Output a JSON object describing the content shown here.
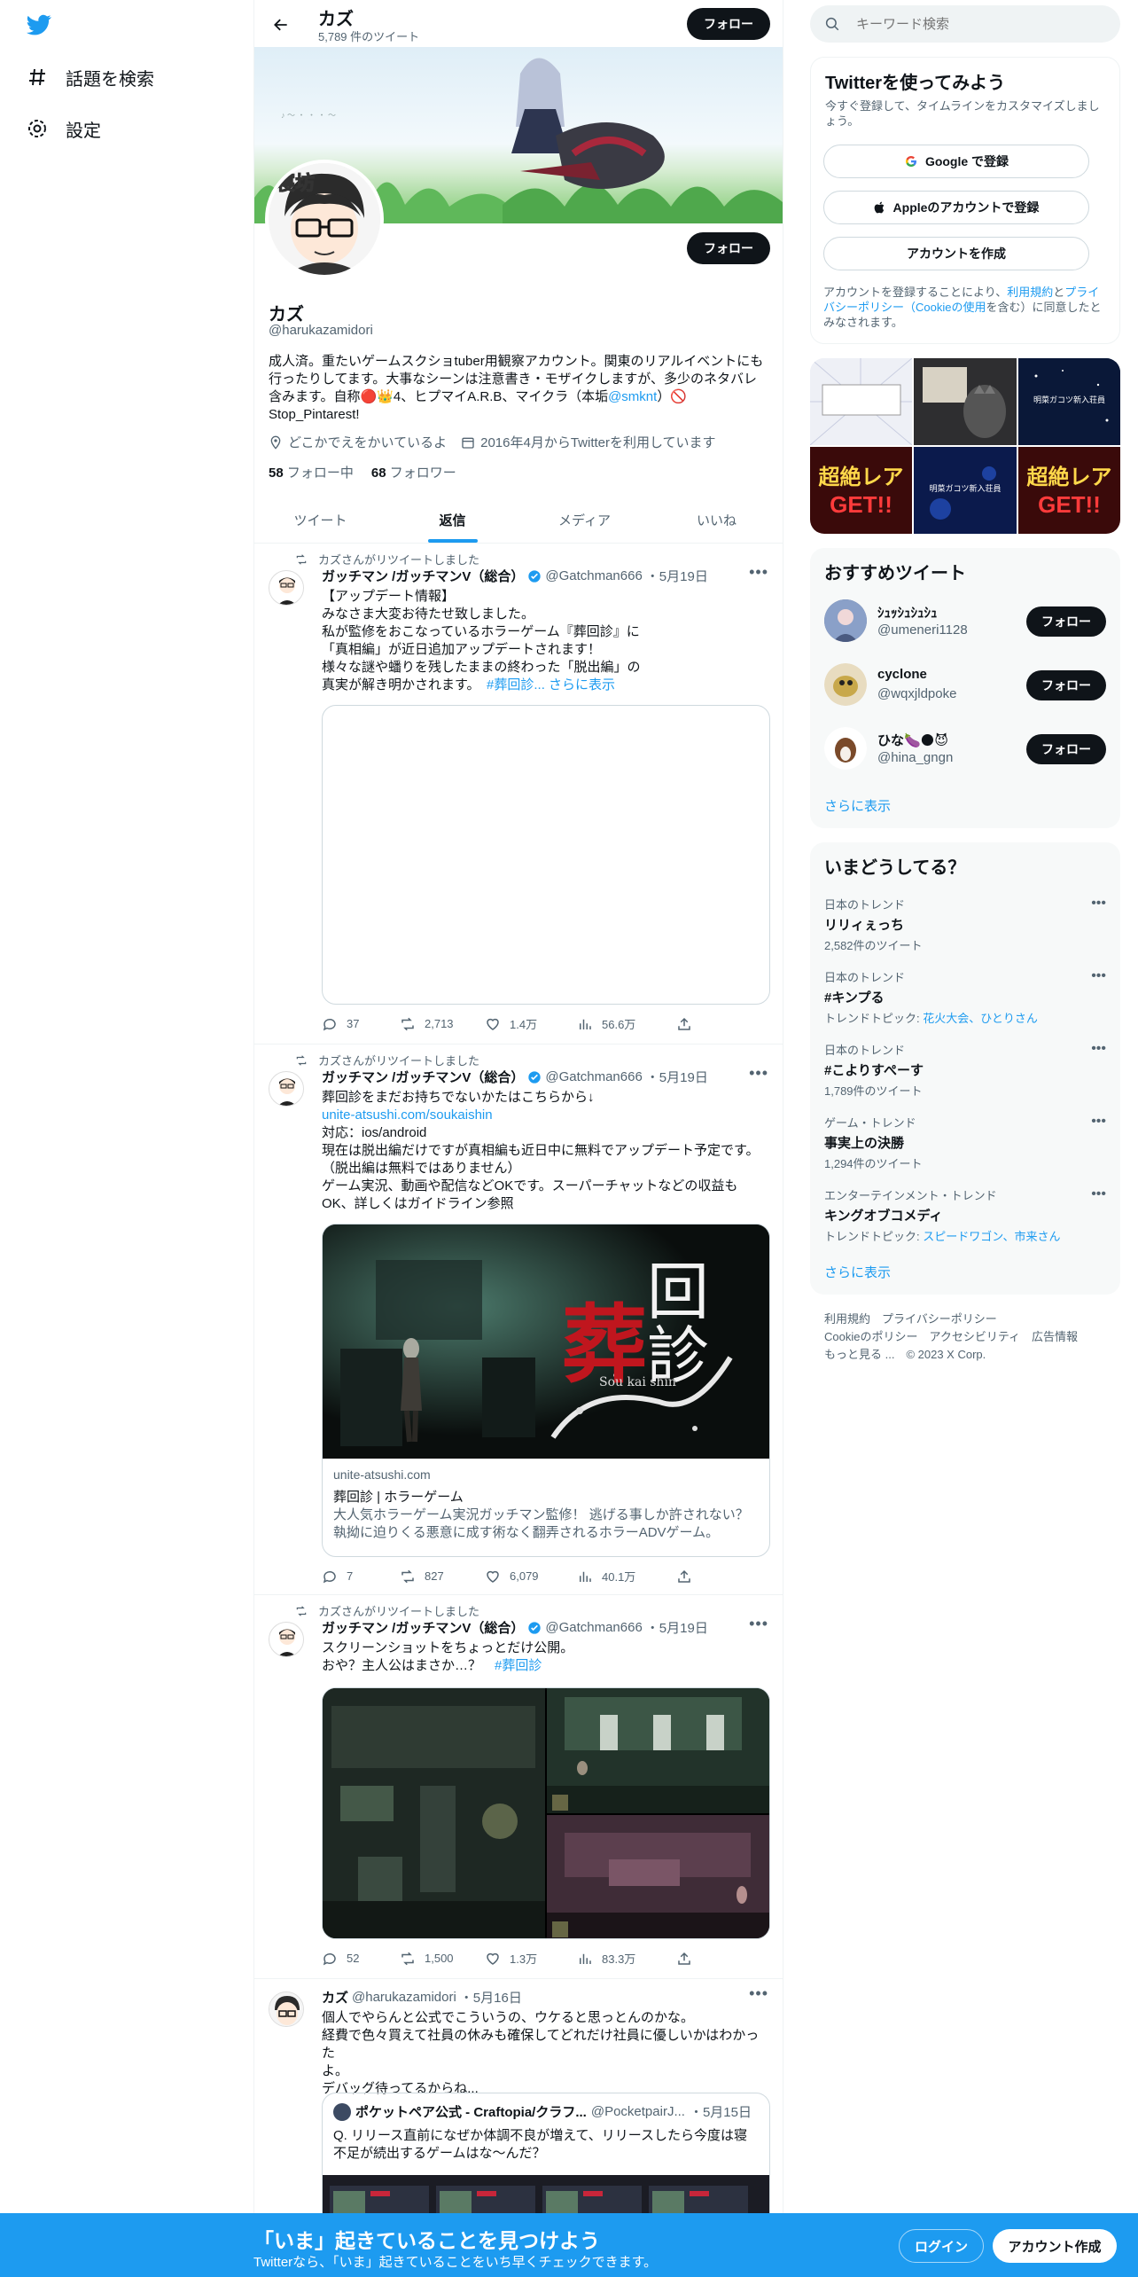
{
  "nav": {
    "search_label": "話題を検索",
    "settings_label": "設定"
  },
  "header": {
    "name": "カズ",
    "tweet_count": "5,789 件のツイート",
    "follow_label": "フォロー"
  },
  "profile": {
    "name": "カズ",
    "handle": "@harukazamidori",
    "follow_label": "フォロー",
    "bio_line1": "成人済。重たいゲームスクショtuber用観察アカウント。関東のリアルイベントにも",
    "bio_line2": "行ったりしてます。大事なシーンは注意書き・モザイクしますが、多少のネタバレ",
    "bio_line3a": "含みます。自称🔴👑4、ヒプマイA.R.B、マイクラ（本垢",
    "bio_mention": "@smknt",
    "bio_line3b": "）🚫",
    "bio_line4": "Stop_Pintarest!",
    "location": "どこかでえをかいているよ",
    "joined": "2016年4月からTwitterを利用しています",
    "following_count": "58",
    "following_label": "フォロー中",
    "followers_count": "68",
    "followers_label": "フォロワー"
  },
  "tabs": [
    "ツイート",
    "返信",
    "メディア",
    "いいね"
  ],
  "tweets": [
    {
      "retweet_label": "カズさんがリツイートしました",
      "author": "ガッチマン /ガッチマンV（総合）",
      "handle": "@Gatchman666",
      "date": "・5月19日",
      "lines": [
        "【アップデート情報】",
        "みなさま大変お待たせ致しました。",
        "私が監修をおこなっているホラーゲーム『葬回診』に",
        "「真相編」が近日追加アップデートされます！",
        "様々な謎や蟠りを残したままの終わった「脱出編」の"
      ],
      "last_line": "真実が解き明かされます。",
      "hashtag": "#葬回診",
      "show_more": "... さらに表示",
      "replies": "37",
      "retweets": "2,713",
      "likes": "1.4万",
      "views": "56.6万"
    },
    {
      "retweet_label": "カズさんがリツイートしました",
      "author": "ガッチマン /ガッチマンV（総合）",
      "handle": "@Gatchman666",
      "date": "・5月19日",
      "line1": "葬回診をまだお持ちでないかたはこちらから↓",
      "link": "unite-atsushi.com/soukaishin",
      "lines": [
        "対応：ios/android",
        "現在は脱出編だけですが真相編も近日中に無料でアップデート予定です。",
        "（脱出編は無料ではありません）",
        "ゲーム実況、動画や配信などOKです。スーパーチャットなどの収益も",
        "OK、詳しくはガイドライン参照"
      ],
      "card_title_a": "葬",
      "card_title_b": "回診",
      "card_sub": "Sou kai shin",
      "card_domain": "unite-atsushi.com",
      "card_title": "葬回診 | ホラーゲーム",
      "card_desc1": "大人気ホラーゲーム実況ガッチマン監修！ 逃げる事しか許されない？",
      "card_desc2": "執拗に迫りくる悪意に成す術なく翻弄されるホラーADVゲーム。",
      "replies": "7",
      "retweets": "827",
      "likes": "6,079",
      "views": "40.1万"
    },
    {
      "retweet_label": "カズさんがリツイートしました",
      "author": "ガッチマン /ガッチマンV（総合）",
      "handle": "@Gatchman666",
      "date": "・5月19日",
      "line1": "スクリーンショットをちょっとだけ公開。",
      "line2": "おや？主人公はまさか…？",
      "hashtag": "#葬回診",
      "replies": "52",
      "retweets": "1,500",
      "likes": "1.3万",
      "views": "83.3万"
    },
    {
      "author": "カズ",
      "handle": "@harukazamidori",
      "date": "・5月16日",
      "lines": [
        "個人でやらんと公式でこういうの、ウケると思っとんのかな。",
        "経費で色々買えて社員の休みも確保してどれだけ社員に優しいかはわかった",
        "よ。",
        "デバッグ待ってるからね..."
      ],
      "quote_author": "ポケットペア公式 - Craftopia/クラフ...",
      "quote_handle": "@PocketpairJ...",
      "quote_date": "・5月15日",
      "quote_line1": "Q. リリース直前になぜか体調不良が増えて、リリースしたら今度は寝",
      "quote_line2": "不足が続出するゲームはな～んだ？"
    }
  ],
  "right": {
    "search_placeholder": "キーワード検索",
    "signup_title": "Twitterを使ってみよう",
    "signup_sub": "今すぐ登録して、タイムラインをカスタマイズしましょう。",
    "google_btn": "Google で登録",
    "apple_btn": "Appleのアカウントで登録",
    "create_btn": "アカウントを作成",
    "terms_a": "アカウントを登録することにより、",
    "terms_link1": "利用規約",
    "terms_b": "と",
    "terms_link2": "プライバシーポリシー（Cookieの使用",
    "terms_c": "を含む）に同意したとみなされます。",
    "media_labels": [
      "超絶レア",
      "GET!!",
      "明菜ガコツ新入荘員"
    ],
    "recommend_title": "おすすめツイート",
    "recommend": [
      {
        "name": "ｼｭｯｼｭｼｭｼｭ",
        "handle": "@umeneri1128"
      },
      {
        "name": "cyclone",
        "handle": "@wqxjldpoke"
      },
      {
        "name": "ひな🍆🌑😈",
        "handle": "@hina_gngn"
      }
    ],
    "follow_label": "フォロー",
    "show_more": "さらに表示",
    "trends_title": "いまどうしてる？",
    "trends": [
      {
        "cat": "日本のトレンド",
        "name": "リリィぇっち",
        "sub": "2,582件のツイート"
      },
      {
        "cat": "日本のトレンド",
        "name": "#キンプる",
        "sub_label": "トレンドトピック: ",
        "sub_link": "花火大会、ひとりさん"
      },
      {
        "cat": "日本のトレンド",
        "name": "#こよりすぺーす",
        "sub": "1,789件のツイート"
      },
      {
        "cat": "ゲーム・トレンド",
        "name": "事実上の決勝",
        "sub": "1,294件のツイート"
      },
      {
        "cat": "エンターテインメント・トレンド",
        "name": "キングオブコメディ",
        "sub_label": "トレンドトピック: ",
        "sub_link": "スピードワゴン、市来さん"
      }
    ],
    "footer1": "利用規約　プライバシーポリシー",
    "footer2": "Cookieのポリシー　アクセシビリティ　広告情報",
    "footer3": "もっと見る ...　© 2023 X Corp."
  },
  "bottom": {
    "title": "「いま」起きていることを見つけよう",
    "subtitle": "Twitterなら、「いま」起きていることをいち早くチェックできます。",
    "login": "ログイン",
    "signup": "アカウント作成"
  },
  "colors": {
    "accent": "#1d9bf0",
    "text": "#0f1419",
    "muted": "#536471",
    "verified": "#1d9bf0"
  }
}
